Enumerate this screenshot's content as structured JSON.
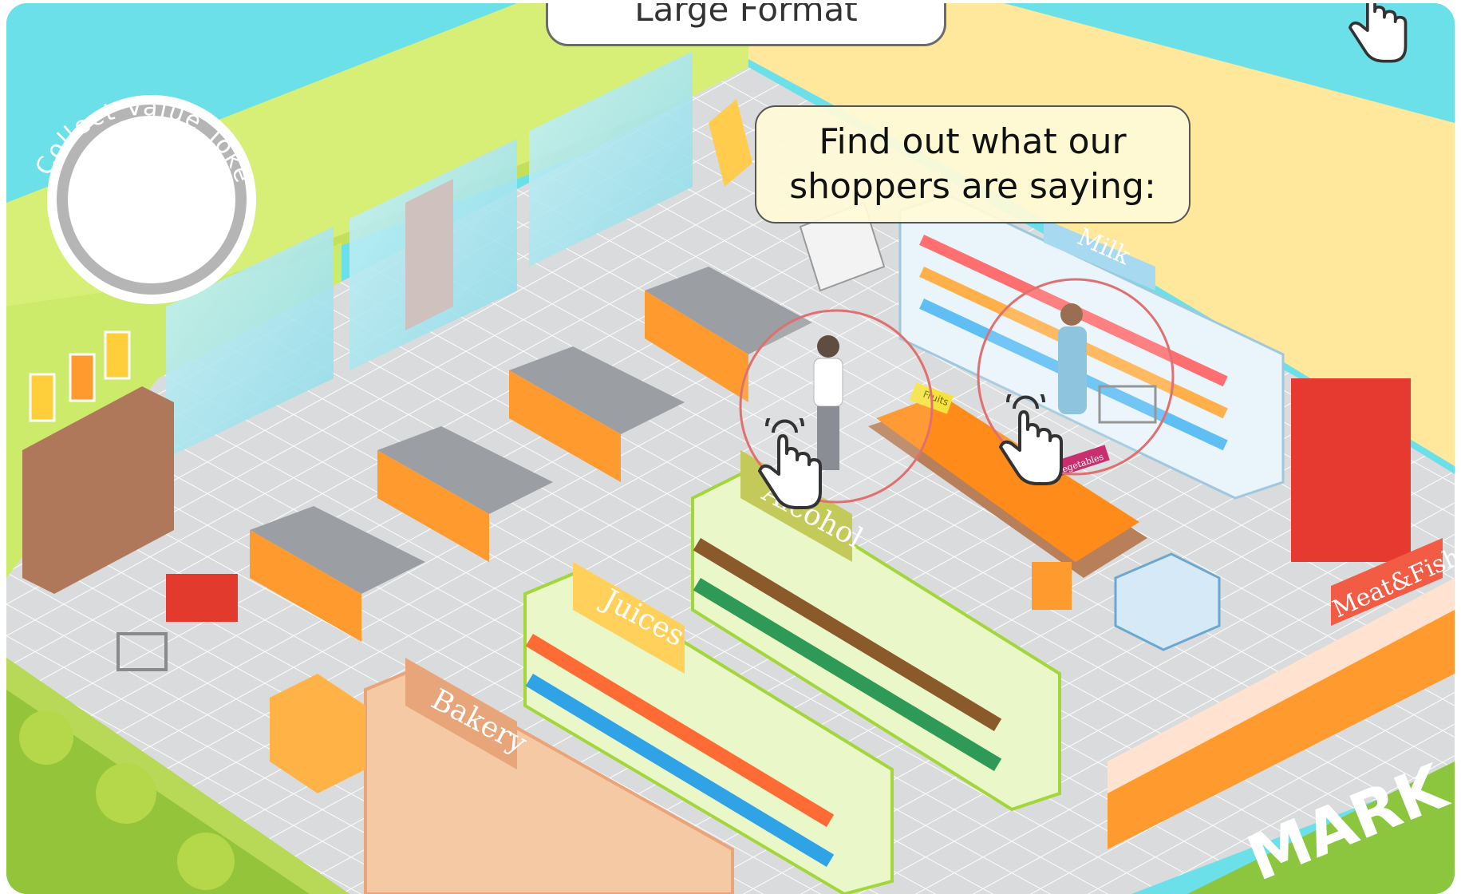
{
  "header": {
    "title": "Large Format"
  },
  "token_badge": {
    "label": "Collect Value Tokens"
  },
  "speech_bubble": {
    "text": "Find out what our\nshoppers are saying:"
  },
  "signs": {
    "milk": "Milk",
    "alcohol": "Alcohol",
    "juices": "Juices",
    "bakery": "Bakery",
    "meat_fish": "Meat&Fish",
    "fruits": "Fruits",
    "vegetables": "Vegetables",
    "storefront": "MARK"
  },
  "colors": {
    "sky": "#6ce0e8",
    "wall_green": "#d9f07a",
    "wall_yellow": "#ffe69a",
    "floor": "#d7d8d9",
    "counter_orange": "#ff9a2e",
    "hotspot_ring": "#e07070"
  },
  "icons": [
    "hand-pointer-icon",
    "token-ring-icon"
  ]
}
